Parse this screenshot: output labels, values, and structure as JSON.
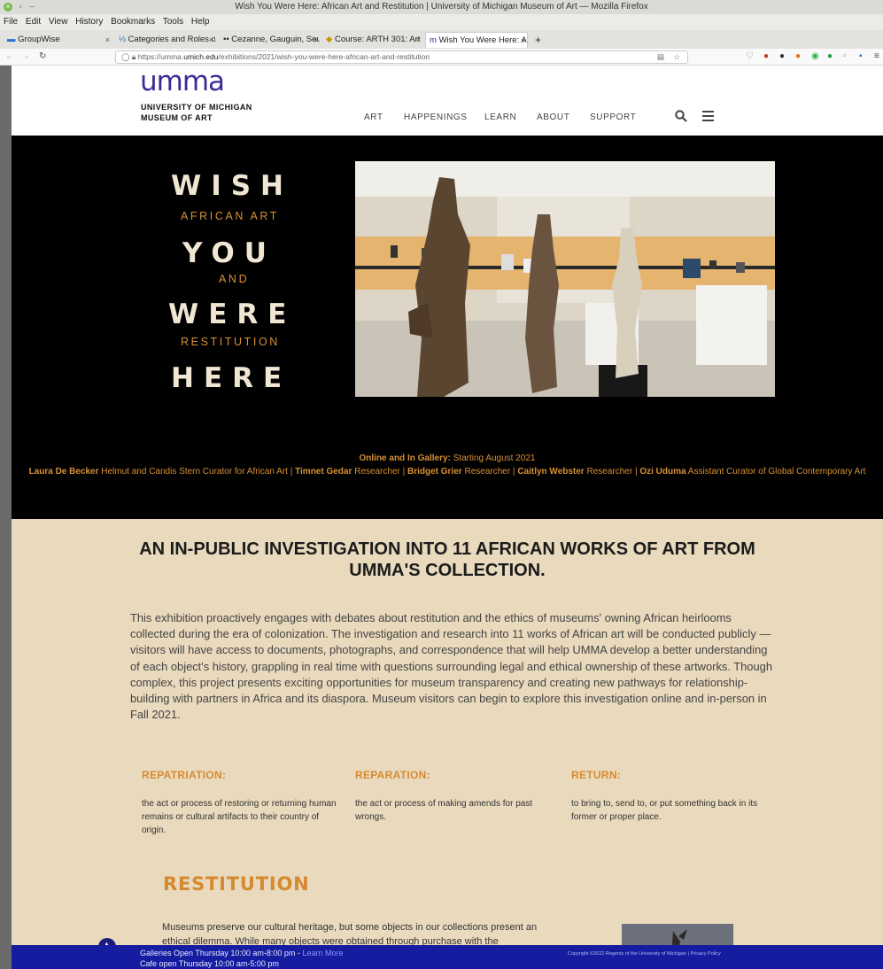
{
  "browser": {
    "window_title": "Wish You Were Here: African Art and Restitution  | University of Michigan Museum of Art — Mozilla Firefox",
    "menu": [
      "File",
      "Edit",
      "View",
      "History",
      "Bookmarks",
      "Tools",
      "Help"
    ],
    "tabs": [
      {
        "label": "GroupWise"
      },
      {
        "label": "Categories and Roles o"
      },
      {
        "label": "Cezanne, Gauguin, Seu"
      },
      {
        "label": "Course: ARTH 301: Art"
      },
      {
        "label": "Wish You Were Here: A"
      }
    ],
    "new_tab": "+",
    "url_prefix": "https://umma.",
    "url_domain": "umich.edu",
    "url_path": "/exhibitions/2021/wish-you-were-here-african-art-and-restitution"
  },
  "site": {
    "logo_mark": "umma",
    "logo_line1": "UNIVERSITY OF MICHIGAN",
    "logo_line2": "MUSEUM OF ART",
    "nav": [
      "ART",
      "HAPPENINGS",
      "LEARN",
      "ABOUT",
      "SUPPORT"
    ]
  },
  "hero": {
    "word1": "WISH",
    "sub1": "AFRICAN ART",
    "word2": "YOU",
    "sub2": "AND",
    "word3": "WERE",
    "sub3": "RESTITUTION",
    "word4": "HERE",
    "schedule_label": "Online and In Gallery:",
    "schedule_value": " Starting August 2021",
    "credits": [
      {
        "name": "Laura De Becker",
        "role": " Helmut and Candis Stern Curator for African Art | "
      },
      {
        "name": "Timnet Gedar",
        "role": " Researcher | "
      },
      {
        "name": "Bridget Grier",
        "role": " Researcher | "
      },
      {
        "name": "Caitlyn Webster",
        "role": " Researcher | "
      },
      {
        "name": "Ozi Uduma",
        "role": " Assistant Curator of Global Contemporary Art"
      }
    ]
  },
  "content": {
    "headline": "AN IN-PUBLIC INVESTIGATION INTO 11 AFRICAN WORKS OF ART FROM UMMA'S COLLECTION.",
    "intro": "This exhibition proactively engages with debates about restitution and the ethics of museums' owning African heirlooms collected during the era of colonization. The investigation and research into 11 works of African art will be conducted publicly — visitors will have access to documents, photographs, and correspondence that will help UMMA develop a better understanding of each object's history, grappling in real time with questions surrounding legal and ethical ownership of these artworks. Though complex, this project presents exciting opportunities for museum transparency and creating new pathways for relationship-building with partners in Africa and its diaspora. Museum visitors can begin to explore this investigation online and in-person in Fall 2021.",
    "terms": [
      {
        "term": "REPATRIATION:",
        "def": "the act or process of restoring or returning human remains or cultural artifacts to their country of origin."
      },
      {
        "term": "REPARATION:",
        "def": "the act or process of making amends for past wrongs."
      },
      {
        "term": "RETURN:",
        "def": "to bring to, send to, or put something back in its former or proper place."
      }
    ],
    "restitution_title": "RESTITUTION",
    "restitution_text": "Museums preserve our cultural heritage, but some objects in our collections present an ethical dilemma. While many objects were obtained through purchase with the"
  },
  "footer": {
    "galleries": "Galleries Open Thursday 10:00 am-8:00 pm - ",
    "learn_more": "Learn More",
    "cafe": "Cafe open Thursday 10:00 am-5:00 pm",
    "copyright": "Copyright ©2022 Regents of the University of Michigan | Privacy Policy"
  },
  "colors": {
    "accent": "#d68a30",
    "brand": "#3b2b94",
    "footer": "#151c9f",
    "hero_bg": "#000000",
    "content_bg": "#e9d9bd"
  }
}
